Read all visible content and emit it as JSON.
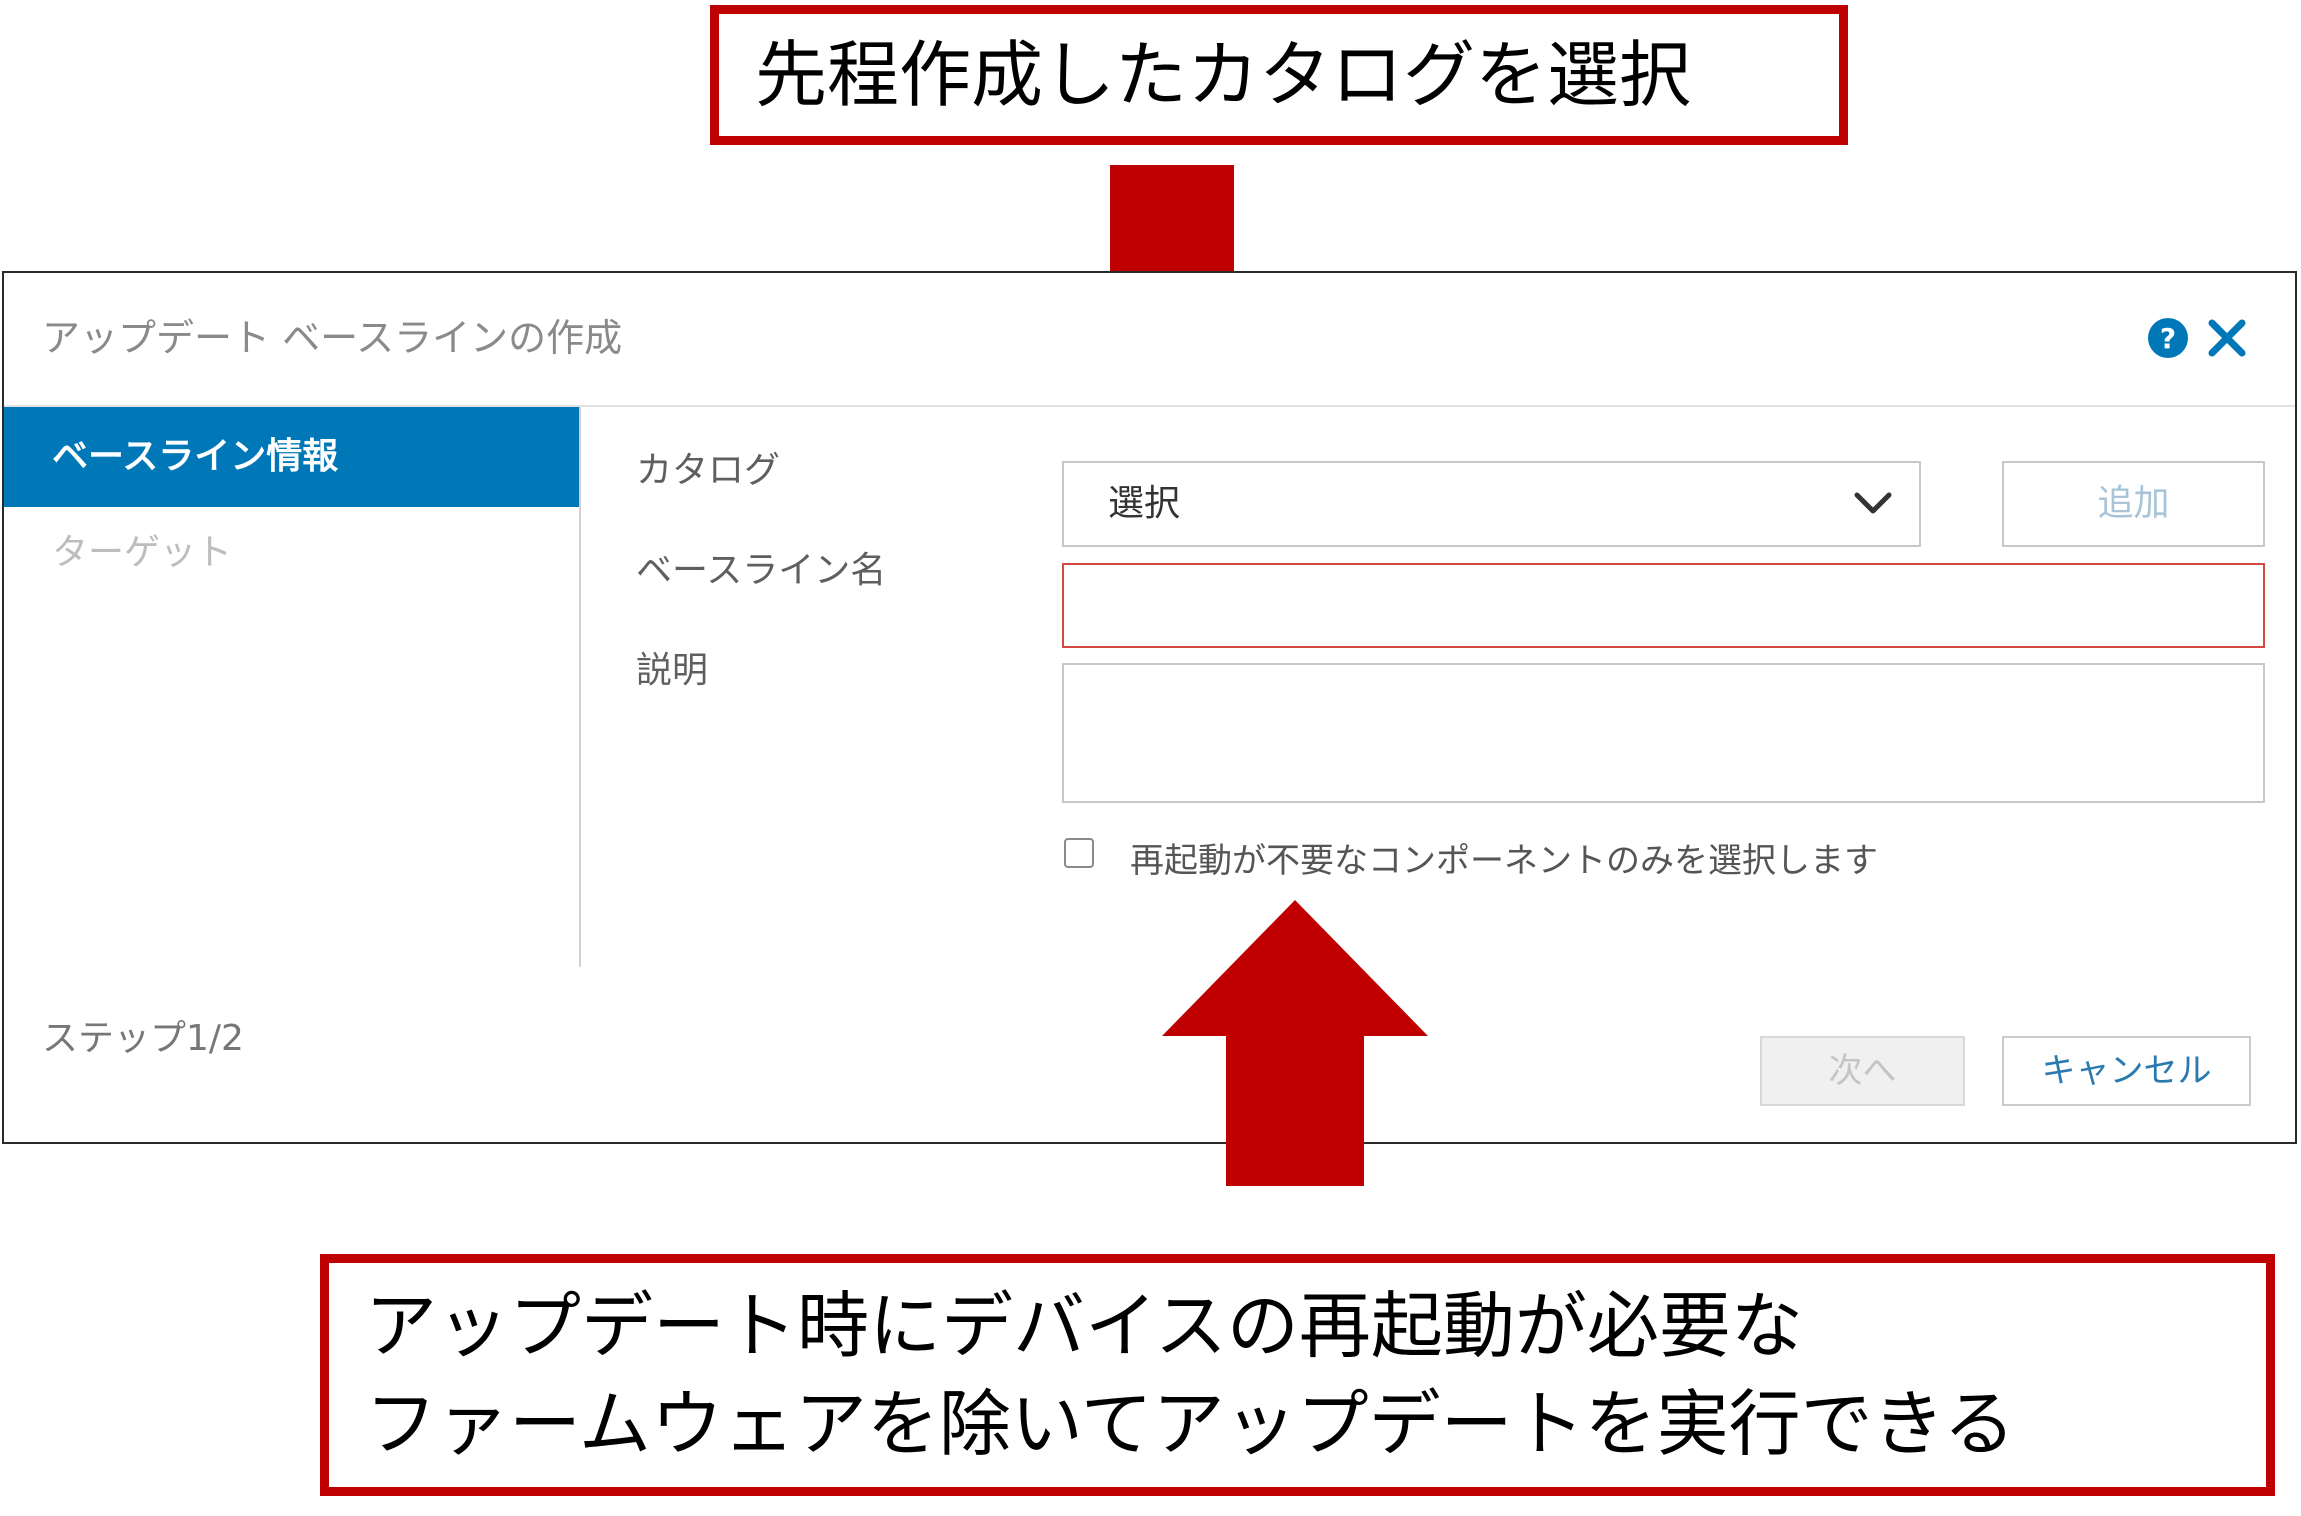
{
  "annotations": {
    "top_callout": "先程作成したカタログを選択",
    "bottom_callout_lines": [
      "アップデート時にデバイスの再起動が必要な",
      "ファームウェアを除いてアップデートを実行できる"
    ],
    "accent_color": "#c00000"
  },
  "dialog": {
    "title": "アップデート ベースラインの作成",
    "header_icons": [
      "help-icon",
      "close-icon"
    ],
    "icon_color": "#0078b8",
    "sidebar": {
      "items": [
        {
          "label": "ベースライン情報",
          "active": true
        },
        {
          "label": "ターゲット",
          "active": false
        }
      ],
      "active_color": "#0078b8"
    },
    "form": {
      "catalog_label": "カタログ",
      "catalog_value": "選択",
      "add_button": "追加",
      "name_label": "ベースライン名",
      "name_value": "",
      "description_label": "説明",
      "description_value": "",
      "reboot_checkbox_label": "再起動が不要なコンポーネントのみを選択します",
      "reboot_checkbox_checked": false
    },
    "footer": {
      "step": "ステップ1/2",
      "next_button": "次へ",
      "cancel_button": "キャンセル"
    }
  }
}
